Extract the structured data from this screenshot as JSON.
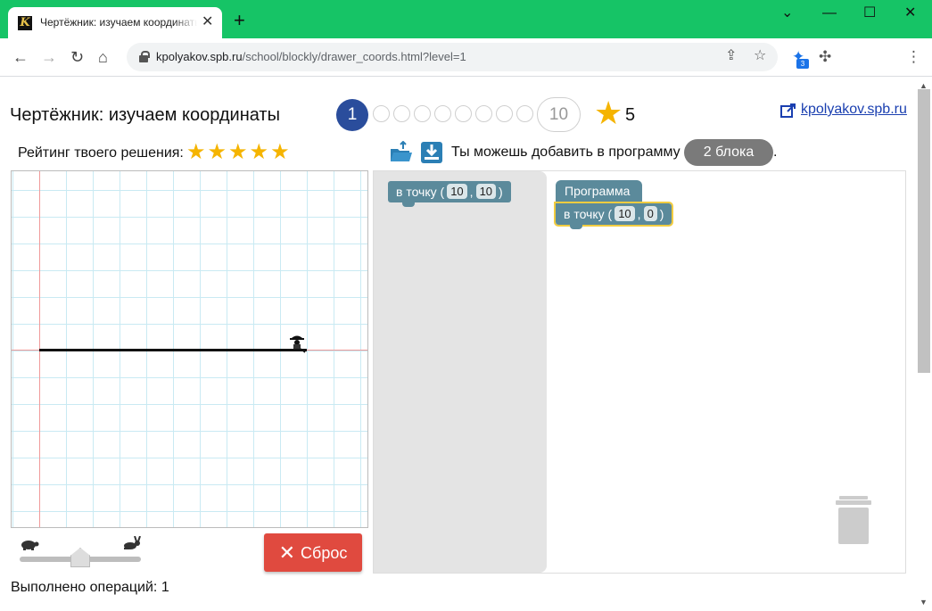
{
  "browser": {
    "tab_title": "Чертёжник: изучаем координаты",
    "tab_close": "✕",
    "new_tab": "+",
    "favicon_letter": "K",
    "url_host": "kpolyakov.spb.ru",
    "url_path": "/school/blockly/drawer_coords.html?level=1",
    "extension_badge": "3",
    "window_controls": {
      "dropdown": "⌄",
      "minimize": "—",
      "maximize": "☐",
      "close": "✕"
    },
    "nav": {
      "back": "←",
      "forward": "→",
      "reload": "↻",
      "home": "⌂"
    }
  },
  "header": {
    "title": "Чертёжник: изучаем координаты",
    "current_level": "1",
    "last_level": "10",
    "level_count": 10,
    "star": "★",
    "star_count": "5",
    "site_link": "kpolyakov.spb.ru"
  },
  "rating": {
    "label": "Рейтинг твоего решения:",
    "stars": "★★★★★",
    "value": 5
  },
  "workspace_toolbar": {
    "hint_text": "Ты можешь добавить в программу",
    "blocks_left": "2 блока",
    "hint_end": "."
  },
  "flyout_block": {
    "label": "в точку (",
    "x": "10",
    "sep": ",",
    "y": "10",
    "close": ")"
  },
  "program": {
    "hat_label": "Программа",
    "block": {
      "label": "в точку (",
      "x": "10",
      "sep": ",",
      "y": "0",
      "close": ")"
    }
  },
  "controls": {
    "speed_slow_icon": "turtle-icon",
    "speed_fast_icon": "rabbit-icon",
    "speed_level": 0.5,
    "reset_icon": "✕",
    "reset_label": "Сброс",
    "operations_label": "Выполнено операций: 1"
  },
  "colors": {
    "chrome_green": "#16c466",
    "level_current": "#2a4d9c",
    "star": "#f5b400",
    "reset": "#e04a3f",
    "block": "#5b8a9b",
    "selection": "#f2cc40",
    "grid": "#c9eaf3",
    "axis": "#f09a9a"
  }
}
